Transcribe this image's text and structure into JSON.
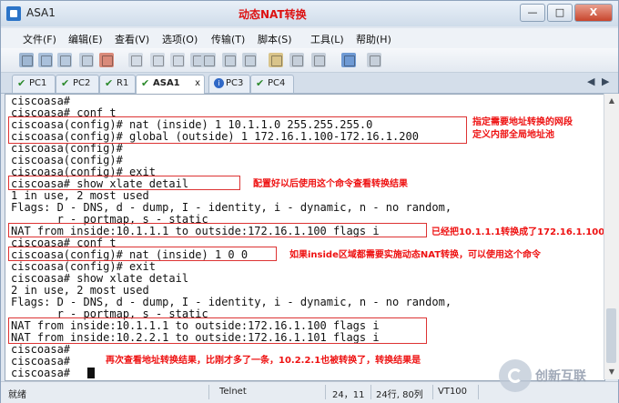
{
  "window": {
    "title": "ASA1",
    "annotation": "动态NAT转换",
    "controls": {
      "minimize": "—",
      "maximize": "□",
      "close": "X"
    }
  },
  "menu": [
    "文件(F)",
    "编辑(E)",
    "查看(V)",
    "选项(O)",
    "传输(T)",
    "脚本(S)",
    "工具(L)",
    "帮助(H)"
  ],
  "toolbar": [
    "connect-icon",
    "quick-connect-icon",
    "reconnect-icon",
    "connect-tab-icon",
    "disconnect-icon",
    "copy-icon",
    "paste-icon",
    "paste-copy-icon",
    "find-icon",
    "print-setup-icon",
    "print-icon",
    "print-screen-icon",
    "session-options-icon",
    "global-options-icon",
    "keymap-icon",
    "help-icon",
    "sftp-icon"
  ],
  "tabs": [
    {
      "label": "PC1",
      "status": "check"
    },
    {
      "label": "PC2",
      "status": "check"
    },
    {
      "label": "R1",
      "status": "check"
    },
    {
      "label": "ASA1",
      "status": "check",
      "active": true,
      "close": "x"
    },
    {
      "label": "PC3",
      "status": "info"
    },
    {
      "label": "PC4",
      "status": "check"
    }
  ],
  "terminal": {
    "lines": [
      "ciscoasa#",
      "ciscoasa# conf t",
      "ciscoasa(config)# nat (inside) 1 10.1.1.0 255.255.255.0",
      "ciscoasa(config)# global (outside) 1 172.16.1.100-172.16.1.200",
      "ciscoasa(config)#",
      "ciscoasa(config)#",
      "ciscoasa(config)# exit",
      "ciscoasa# show xlate detail",
      "1 in use, 2 most used",
      "Flags: D - DNS, d - dump, I - identity, i - dynamic, n - no random,",
      "       r - portmap, s - static",
      "NAT from inside:10.1.1.1 to outside:172.16.1.100 flags i",
      "ciscoasa# conf t",
      "ciscoasa(config)# nat (inside) 1 0 0",
      "ciscoasa(config)# exit",
      "ciscoasa# show xlate detail",
      "2 in use, 2 most used",
      "Flags: D - DNS, d - dump, I - identity, i - dynamic, n - no random,",
      "       r - portmap, s - static",
      "NAT from inside:10.1.1.1 to outside:172.16.1.100 flags i",
      "NAT from inside:10.2.2.1 to outside:172.16.1.101 flags i",
      "ciscoasa#",
      "ciscoasa#",
      "ciscoasa#"
    ]
  },
  "annotations": {
    "a1": "指定需要地址转换的网段",
    "a2": "定义内部全局地址池",
    "a3": "配置好以后使用这个命令查看转换结果",
    "a4": "已经把10.1.1.1转换成了172.16.1.100",
    "a5": "如果inside区域都需要实施动态NAT转换，可以使用这个命令",
    "a6": "再次查看地址转换结果，比刚才多了一条，10.2.2.1也被转换了，转换结果是"
  },
  "status": {
    "ready": "就绪",
    "protocol": "Telnet",
    "cursor": "24，11",
    "size": "24行, 80列",
    "terminal": "VT100"
  },
  "watermark": {
    "text": "创新互联"
  },
  "colors": {
    "annotation": "#e11111",
    "box": "#dd3333"
  }
}
